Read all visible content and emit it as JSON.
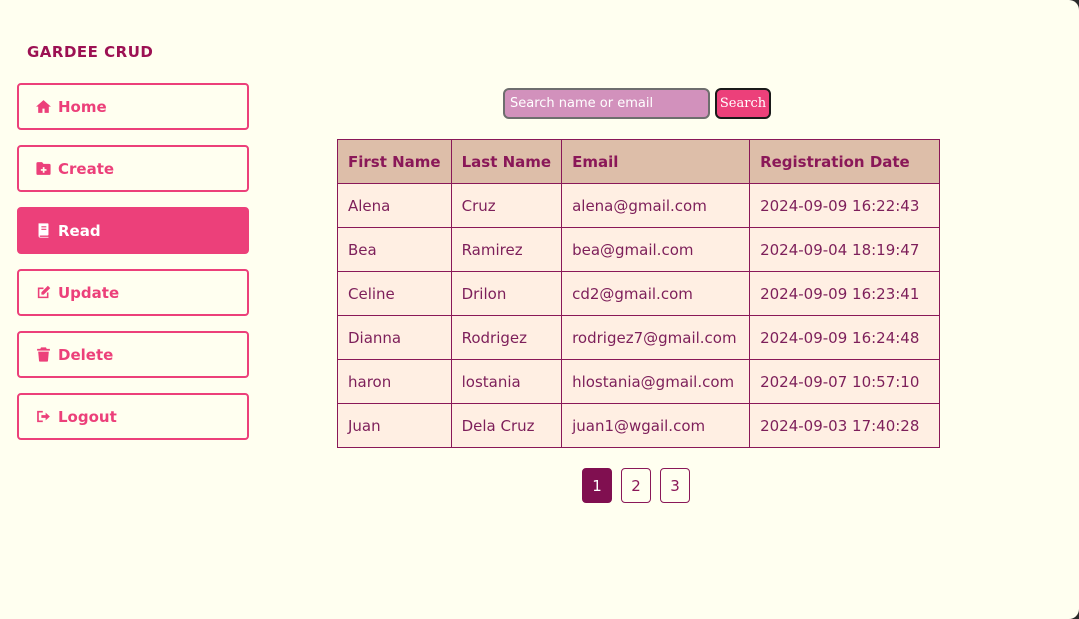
{
  "app": {
    "title": "GARDEE CRUD"
  },
  "sidebar": {
    "items": [
      {
        "label": "Home",
        "icon": "home-icon",
        "active": false
      },
      {
        "label": "Create",
        "icon": "folder-plus-icon",
        "active": false
      },
      {
        "label": "Read",
        "icon": "book-icon",
        "active": true
      },
      {
        "label": "Update",
        "icon": "edit-icon",
        "active": false
      },
      {
        "label": "Delete",
        "icon": "trash-icon",
        "active": false
      },
      {
        "label": "Logout",
        "icon": "logout-icon",
        "active": false
      }
    ]
  },
  "search": {
    "placeholder": "Search name or email",
    "value": "",
    "button_label": "Search"
  },
  "table": {
    "headers": [
      "First Name",
      "Last Name",
      "Email",
      "Registration Date"
    ],
    "rows": [
      [
        "Alena",
        "Cruz",
        "alena@gmail.com",
        "2024-09-09 16:22:43"
      ],
      [
        "Bea",
        "Ramirez",
        "bea@gmail.com",
        "2024-09-04 18:19:47"
      ],
      [
        "Celine",
        "Drilon",
        "cd2@gmail.com",
        "2024-09-09 16:23:41"
      ],
      [
        "Dianna",
        "Rodrigez",
        "rodrigez7@gmail.com",
        "2024-09-09 16:24:48"
      ],
      [
        "haron",
        "lostania",
        "hlostania@gmail.com",
        "2024-09-07 10:57:10"
      ],
      [
        "Juan",
        "Dela Cruz",
        "juan1@wgail.com",
        "2024-09-03 17:40:28"
      ]
    ]
  },
  "pagination": {
    "pages": [
      "1",
      "2",
      "3"
    ],
    "current": "1"
  },
  "colors": {
    "background": "#fffff0",
    "accent": "#ec407a",
    "brand": "#9c1153",
    "table_header": "#ddbea9",
    "table_cell": "#ffefe3",
    "search_field": "#d291bc",
    "active_page": "#800f50"
  }
}
